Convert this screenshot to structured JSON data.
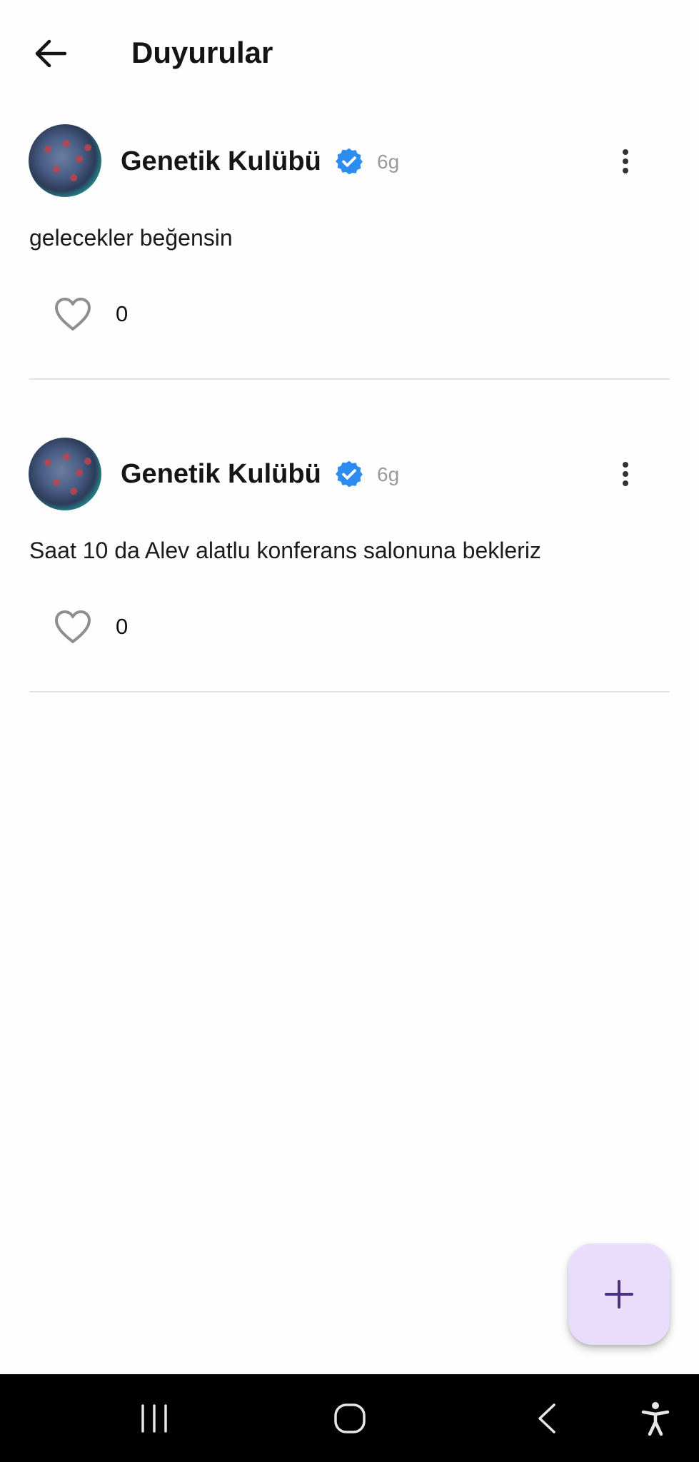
{
  "header": {
    "title": "Duyurular",
    "back_icon": "arrow-left-icon"
  },
  "posts": [
    {
      "author": "Genetik Kulübü",
      "verified": true,
      "time": "6g",
      "content": "gelecekler beğensin",
      "likes": "0"
    },
    {
      "author": "Genetik Kulübü",
      "verified": true,
      "time": "6g",
      "content": "Saat 10 da Alev alatlu konferans salonuna bekleriz",
      "likes": "0"
    }
  ],
  "fab": {
    "icon": "plus-icon"
  },
  "colors": {
    "verified_badge": "#2d8cf0",
    "fab_background": "#e9ddfb",
    "fab_icon": "#4b2f82",
    "divider": "#e3e3e3",
    "timestamp": "#9a9a9a"
  },
  "system_nav": {
    "items": [
      "recents-icon",
      "home-icon",
      "back-icon",
      "accessibility-icon"
    ]
  }
}
